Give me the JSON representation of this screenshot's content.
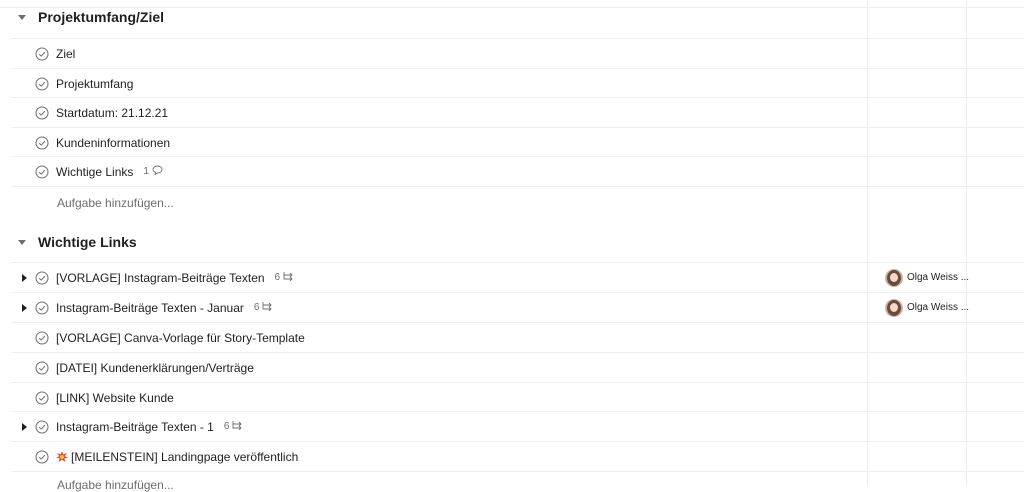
{
  "sections": [
    {
      "title": "Projektumfang/Ziel",
      "tasks": [
        {
          "name": "Ziel"
        },
        {
          "name": "Projektumfang"
        },
        {
          "name": "Startdatum: 21.12.21"
        },
        {
          "name": "Kundeninformationen"
        },
        {
          "name": "Wichtige Links",
          "comments": "1"
        }
      ],
      "add_task": "Aufgabe hinzufügen..."
    },
    {
      "title": "Wichtige Links",
      "tasks": [
        {
          "name": "[VORLAGE] Instagram-Beiträge Texten",
          "subtasks": "6",
          "assignee": "Olga Weiss ..."
        },
        {
          "name": "Instagram-Beiträge Texten - Januar",
          "subtasks": "6",
          "assignee": "Olga Weiss ..."
        },
        {
          "name": "[VORLAGE] Canva-Vorlage für Story-Template"
        },
        {
          "name": "[DATEI] Kundenerklärungen/Verträge"
        },
        {
          "name": "[LINK] Website Kunde"
        },
        {
          "name": "Instagram-Beiträge Texten - 1",
          "subtasks": "6"
        },
        {
          "name": "[MEILENSTEIN] Landingpage veröffentlich",
          "icon": "milestone-emoji-icon"
        }
      ],
      "add_task": "Aufgabe hinzufügen..."
    }
  ]
}
